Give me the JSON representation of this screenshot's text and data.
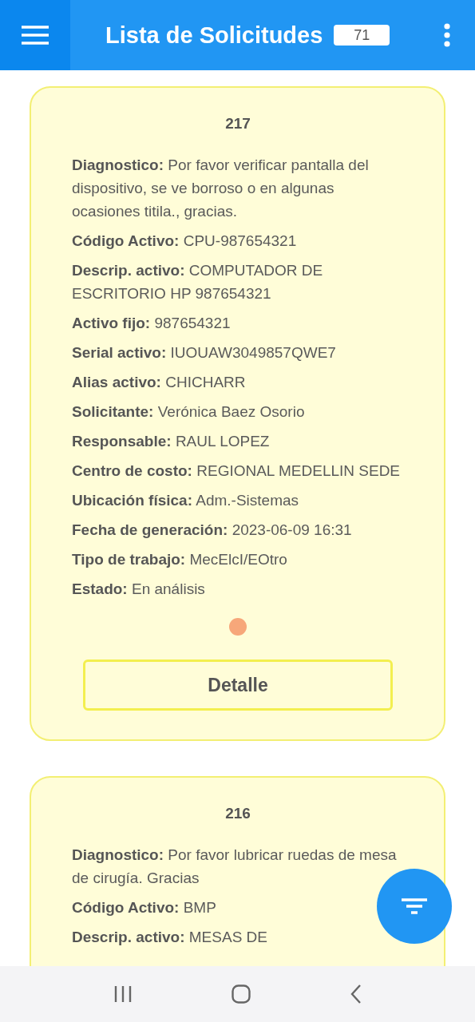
{
  "header": {
    "title": "Lista de Solicitudes",
    "count": "71"
  },
  "requests": [
    {
      "number": "217",
      "color": "#f7a77a",
      "button": "Detalle",
      "fields": [
        {
          "label": "Diagnostico:",
          "value": "Por favor verificar pantalla del dispositivo, se ve borroso o en algunas ocasiones titila., gracias."
        },
        {
          "label": "Código Activo:",
          "value": "CPU-987654321"
        },
        {
          "label": "Descrip. activo:",
          "value": "COMPUTADOR DE ESCRITORIO HP 987654321"
        },
        {
          "label": "Activo fijo:",
          "value": "987654321"
        },
        {
          "label": "Serial activo:",
          "value": "IUOUAW3049857QWE7"
        },
        {
          "label": "Alias activo:",
          "value": "CHICHARR"
        },
        {
          "label": "Solicitante:",
          "value": "Verónica Baez Osorio"
        },
        {
          "label": "Responsable:",
          "value": "RAUL LOPEZ"
        },
        {
          "label": "Centro de costo:",
          "value": "REGIONAL MEDELLIN SEDE"
        },
        {
          "label": "Ubicación física:",
          "value": "Adm.-Sistemas"
        },
        {
          "label": "Fecha de generación:",
          "value": "2023-06-09 16:31"
        },
        {
          "label": "Tipo de trabajo:",
          "value": "MecElcI/EOtro"
        },
        {
          "label": "Estado:",
          "value": "En análisis"
        }
      ]
    },
    {
      "number": "216",
      "fields": [
        {
          "label": "Diagnostico:",
          "value": "Por favor lubricar ruedas de mesa de cirugía.  Gracias"
        },
        {
          "label": "Código Activo:",
          "value": "BMP"
        },
        {
          "label": "Descrip. activo:",
          "value": "MESAS DE"
        }
      ]
    }
  ]
}
